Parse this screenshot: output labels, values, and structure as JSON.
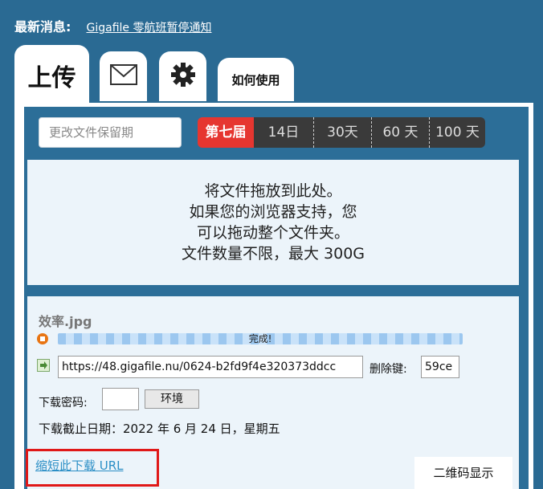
{
  "news": {
    "label": "最新消息:",
    "link": "Gigafile 零航班暂停通知"
  },
  "tabs": {
    "upload": "上传",
    "mail_icon": "mail-icon",
    "settings_icon": "gear-icon",
    "help": "如何使用"
  },
  "retention": {
    "placeholder": "更改文件保留期",
    "options": [
      "第七届",
      "14日",
      "30天",
      "60 天",
      "100 天"
    ],
    "selected_index": 0
  },
  "dropzone": {
    "lines": [
      "将文件拖放到此处。",
      "如果您的浏览器支持，您",
      "可以拖动整个文件夹。",
      "文件数量不限，最大 300G"
    ]
  },
  "file": {
    "name": "效率.jpg",
    "status": "完成!",
    "progress": 1.0,
    "url": "https://48.gigafile.nu/0624-b2fd9f4e320373ddcc",
    "delete_key_label": "删除键:",
    "delete_key": "59ce",
    "password_label": "下载密码:",
    "password": "",
    "env_button": "环境",
    "deadline": "下载截止日期：2022 年 6 月 24 日，星期五",
    "shorten_link": "缩短此下载 URL",
    "qr_button": "二维码显示"
  },
  "colors": {
    "background": "#2a6a93",
    "accent_active": "#e63630",
    "link": "#2c8fc6",
    "highlight_border": "#e01818"
  }
}
